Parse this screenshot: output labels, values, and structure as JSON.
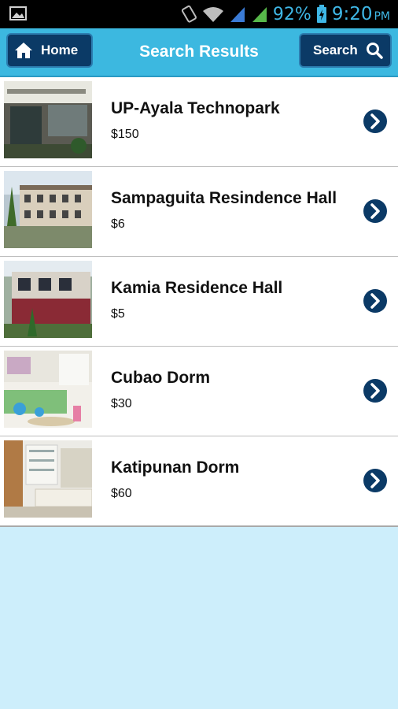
{
  "statusbar": {
    "battery_percent": "92%",
    "time": "9:20",
    "ampm": "PM"
  },
  "header": {
    "home_label": "Home",
    "title": "Search Results",
    "search_label": "Search"
  },
  "results": [
    {
      "name": "UP-Ayala Technopark",
      "price": "$150"
    },
    {
      "name": "Sampaguita Resindence Hall",
      "price": "$6"
    },
    {
      "name": "Kamia Residence Hall",
      "price": "$5"
    },
    {
      "name": "Cubao Dorm",
      "price": "$30"
    },
    {
      "name": "Katipunan Dorm",
      "price": "$60"
    }
  ],
  "colors": {
    "accent": "#3cb8e0",
    "button": "#0b3a66",
    "background": "#cdeefb"
  }
}
